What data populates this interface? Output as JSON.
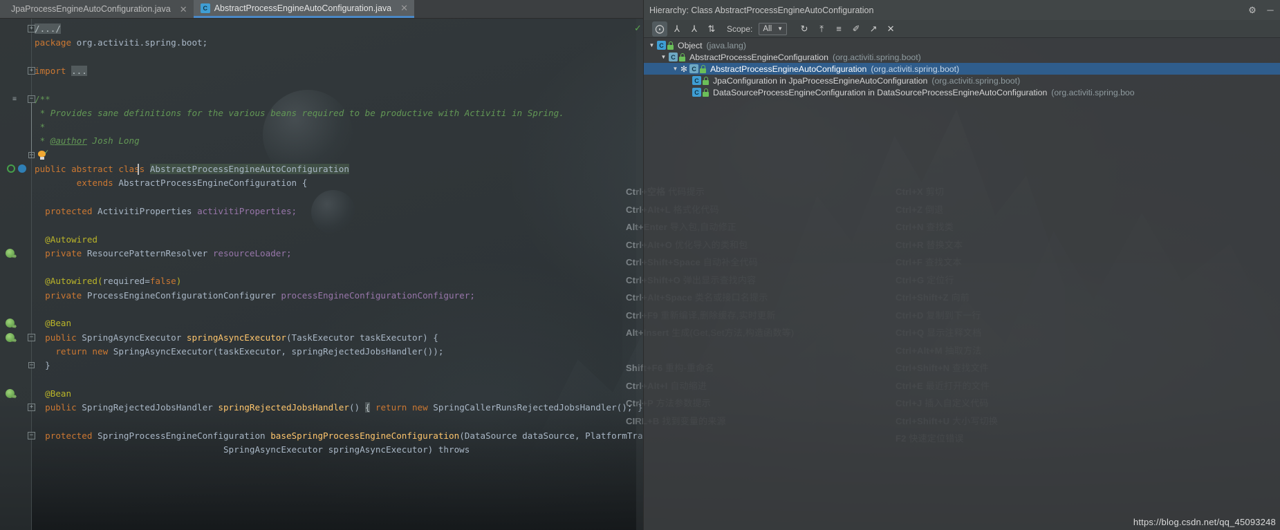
{
  "editor": {
    "tabs": [
      {
        "label": "JpaProcessEngineAutoConfiguration.java",
        "icon": "java-class-icon",
        "icon_letter": "C",
        "active": false,
        "closable": true
      },
      {
        "label": "AbstractProcessEngineAutoConfiguration.java",
        "icon": "java-class-icon",
        "icon_letter": "C",
        "active": true,
        "closable": true
      }
    ],
    "lines": [
      {
        "t": 0,
        "segments": [
          {
            "text": "/.../",
            "cls": "fold-hl"
          }
        ],
        "gutter": "fold-plus"
      },
      {
        "t": 1,
        "segments": [
          {
            "text": "package ",
            "cls": "kw"
          },
          {
            "text": "org.activiti.spring.boot;",
            "cls": "typ"
          }
        ]
      },
      {
        "t": 2,
        "segments": []
      },
      {
        "t": 3,
        "segments": [
          {
            "text": "import ",
            "cls": "kw"
          },
          {
            "text": "...",
            "cls": "fold-hl"
          }
        ],
        "gutter": "fold-plus"
      },
      {
        "t": 4,
        "segments": []
      },
      {
        "t": 5,
        "segments": [
          {
            "text": "/**",
            "cls": "cmtb"
          }
        ],
        "gutter": "fold-minus"
      },
      {
        "t": 6,
        "segments": [
          {
            "text": " * Provides sane definitions for the various beans required to be productive with Activiti in Spring.",
            "cls": "cmt"
          }
        ]
      },
      {
        "t": 7,
        "segments": [
          {
            "text": " *",
            "cls": "cmt"
          }
        ]
      },
      {
        "t": 8,
        "segments": [
          {
            "text": " * ",
            "cls": "cmt"
          },
          {
            "text": "@author",
            "cls": "cmt underline"
          },
          {
            "text": " Josh Long",
            "cls": "cmt"
          }
        ]
      },
      {
        "t": 9,
        "segments": [],
        "gutter": "brace-end"
      },
      {
        "t": 10,
        "segments": [
          {
            "text": "public abstract class ",
            "cls": "kw"
          },
          {
            "text": "AbstractProcessEngineAutoConfiguration",
            "cls": "cls-hl"
          }
        ],
        "gutter": "impl-override"
      },
      {
        "t": 11,
        "segments": [
          {
            "text": "        extends ",
            "cls": "kw"
          },
          {
            "text": "AbstractProcessEngineConfiguration {",
            "cls": "typ"
          }
        ]
      },
      {
        "t": 12,
        "segments": []
      },
      {
        "t": 13,
        "segments": [
          {
            "text": "  protected ",
            "cls": "kw"
          },
          {
            "text": "ActivitiProperties ",
            "cls": "typ"
          },
          {
            "text": "activitiProperties;",
            "cls": "fld"
          }
        ]
      },
      {
        "t": 14,
        "segments": []
      },
      {
        "t": 15,
        "segments": [
          {
            "text": "  @Autowired",
            "cls": "anno"
          }
        ]
      },
      {
        "t": 16,
        "segments": [
          {
            "text": "  private ",
            "cls": "kw"
          },
          {
            "text": "ResourcePatternResolver ",
            "cls": "typ"
          },
          {
            "text": "resourceLoader;",
            "cls": "fld"
          }
        ],
        "gutter": "spring-bean"
      },
      {
        "t": 17,
        "segments": []
      },
      {
        "t": 18,
        "segments": [
          {
            "text": "  @Autowired(",
            "cls": "anno"
          },
          {
            "text": "required=",
            "cls": "typ"
          },
          {
            "text": "false",
            "cls": "kw"
          },
          {
            "text": ")",
            "cls": "anno"
          }
        ]
      },
      {
        "t": 19,
        "segments": [
          {
            "text": "  private ",
            "cls": "kw"
          },
          {
            "text": "ProcessEngineConfigurationConfigurer ",
            "cls": "typ"
          },
          {
            "text": "processEngineConfigurationConfigurer;",
            "cls": "fld"
          }
        ]
      },
      {
        "t": 20,
        "segments": []
      },
      {
        "t": 21,
        "segments": [
          {
            "text": "  @Bean",
            "cls": "anno"
          }
        ],
        "gutter": "spring-bean"
      },
      {
        "t": 22,
        "segments": [
          {
            "text": "  public ",
            "cls": "kw"
          },
          {
            "text": "SpringAsyncExecutor ",
            "cls": "typ"
          },
          {
            "text": "springAsyncExecutor",
            "cls": "mth"
          },
          {
            "text": "(TaskExecutor taskExecutor) {",
            "cls": "typ"
          }
        ],
        "gutter": "spring-bean-fold"
      },
      {
        "t": 23,
        "segments": [
          {
            "text": "    return new ",
            "cls": "kw"
          },
          {
            "text": "SpringAsyncExecutor(taskExecutor, springRejectedJobsHandler());",
            "cls": "typ"
          }
        ]
      },
      {
        "t": 24,
        "segments": [
          {
            "text": "  }",
            "cls": "typ"
          }
        ],
        "gutter": "brace-end"
      },
      {
        "t": 25,
        "segments": []
      },
      {
        "t": 26,
        "segments": [
          {
            "text": "  @Bean",
            "cls": "anno"
          }
        ],
        "gutter": "spring-bean"
      },
      {
        "t": 27,
        "segments": [
          {
            "text": "  public ",
            "cls": "kw"
          },
          {
            "text": "SpringRejectedJobsHandler ",
            "cls": "typ"
          },
          {
            "text": "springRejectedJobsHandler",
            "cls": "mth"
          },
          {
            "text": "() ",
            "cls": "typ"
          },
          {
            "text": "{",
            "cls": "fold-hl"
          },
          {
            "text": " return new ",
            "cls": "kw"
          },
          {
            "text": "SpringCallerRunsRejectedJobsHandler(); }",
            "cls": "typ"
          }
        ],
        "gutter": "fold-plus"
      },
      {
        "t": 28,
        "segments": []
      },
      {
        "t": 29,
        "segments": [
          {
            "text": "  protected ",
            "cls": "kw"
          },
          {
            "text": "SpringProcessEngineConfiguration ",
            "cls": "typ"
          },
          {
            "text": "baseSpringProcessEngineConfiguration",
            "cls": "mth"
          },
          {
            "text": "(DataSource dataSource, PlatformTransactionManage",
            "cls": "typ"
          }
        ],
        "gutter": "fold-minus"
      },
      {
        "t": 30,
        "segments": [
          {
            "text": "                                    SpringAsyncExecutor springAsyncExecutor) throws",
            "cls": "typ"
          }
        ]
      }
    ]
  },
  "hierarchy": {
    "title": "Hierarchy:  Class AbstractProcessEngineAutoConfiguration",
    "window_actions": [
      {
        "name": "settings-gear-icon",
        "glyph": "⚙"
      },
      {
        "name": "minimize-icon",
        "glyph": "─"
      }
    ],
    "toolbar": {
      "buttons": [
        {
          "name": "type-hierarchy-icon",
          "glyph": "⨀",
          "selected": true
        },
        {
          "name": "supertypes-hierarchy-icon",
          "glyph": "⅄",
          "selected": false
        },
        {
          "name": "subtypes-hierarchy-icon",
          "glyph": "⅄",
          "selected": false
        },
        {
          "name": "sort-alphabetically-icon",
          "glyph": "⇅",
          "selected": false
        }
      ],
      "scope_label": "Scope:",
      "scope_value": "All",
      "right_buttons": [
        {
          "name": "refresh-icon",
          "glyph": "↻"
        },
        {
          "name": "export-to-text-icon",
          "glyph": "⤒"
        },
        {
          "name": "expand-all-icon",
          "glyph": "≡"
        },
        {
          "name": "pin-tab-icon",
          "glyph": "✐"
        },
        {
          "name": "open-in-new-window-icon",
          "glyph": "↗"
        },
        {
          "name": "close-icon",
          "glyph": "✕"
        }
      ]
    },
    "tree": [
      {
        "indent": 0,
        "arrow": "▼",
        "star": false,
        "name": "Object",
        "pkg": "(java.lang)",
        "selected": false,
        "abstract": false
      },
      {
        "indent": 1,
        "arrow": "▼",
        "star": false,
        "name": "AbstractProcessEngineConfiguration",
        "pkg": "(org.activiti.spring.boot)",
        "selected": false,
        "abstract": true
      },
      {
        "indent": 2,
        "arrow": "▼",
        "star": true,
        "name": "AbstractProcessEngineAutoConfiguration",
        "pkg": "(org.activiti.spring.boot)",
        "selected": true,
        "abstract": true
      },
      {
        "indent": 3,
        "arrow": "",
        "star": false,
        "name": "JpaConfiguration in JpaProcessEngineAutoConfiguration",
        "pkg": "(org.activiti.spring.boot)",
        "selected": false,
        "abstract": false
      },
      {
        "indent": 3,
        "arrow": "",
        "star": false,
        "name": "DataSourceProcessEngineConfiguration in DataSourceProcessEngineAutoConfiguration",
        "pkg": "(org.activiti.spring.boo",
        "selected": false,
        "abstract": false
      }
    ]
  },
  "shortcuts_overlay": {
    "left_column": [
      {
        "key": "Ctrl+空格",
        "desc": "代码提示"
      },
      {
        "key": "Ctrl+Alt+L",
        "desc": "格式化代码"
      },
      {
        "key": "Alt+Enter",
        "desc": "导入包,自动修正"
      },
      {
        "key": "Ctrl+Alt+O",
        "desc": "优化导入的类和包"
      },
      {
        "key": "Ctrl+Shift+Space",
        "desc": "自动补全代码"
      },
      {
        "key": "Ctrl+Shift+O",
        "desc": "弹出显示查找内容"
      },
      {
        "key": "Ctrl+Alt+Space",
        "desc": "类名或接口名提示"
      },
      {
        "key": "Ctrl+F9",
        "desc": "重新编译,删除缓存,实时更新"
      },
      {
        "key": "Alt+Insert",
        "desc": "生成(Get,Set方法,构造函数等)"
      },
      {
        "key": "",
        "desc": ""
      },
      {
        "key": "Shift+F6",
        "desc": "重构-重命名"
      },
      {
        "key": "Ctrl+Alt+I",
        "desc": "自动缩进"
      },
      {
        "key": "Ctrl+P",
        "desc": "方法参数提示"
      },
      {
        "key": "CIRL+B",
        "desc": "找到变量的来源"
      }
    ],
    "right_column": [
      {
        "key": "Ctrl+X",
        "desc": "剪切"
      },
      {
        "key": "Ctrl+Z",
        "desc": "倒退"
      },
      {
        "key": "Ctrl+N",
        "desc": "查找类"
      },
      {
        "key": "Ctrl+R",
        "desc": "替换文本"
      },
      {
        "key": "Ctrl+F",
        "desc": "查找文本"
      },
      {
        "key": "Ctrl+G",
        "desc": "定位行"
      },
      {
        "key": "Ctrl+Shift+Z",
        "desc": "向前"
      },
      {
        "key": "Ctrl+D",
        "desc": "复制到下一行"
      },
      {
        "key": "Ctrl+Q",
        "desc": "显示注释文档"
      },
      {
        "key": "Ctrl+Alt+M",
        "desc": "抽取方法"
      },
      {
        "key": "Ctrl+Shift+N",
        "desc": "查找文件"
      },
      {
        "key": "Ctrl+E",
        "desc": "最近打开的文件"
      },
      {
        "key": "Ctrl+J",
        "desc": "插入自定义代码"
      },
      {
        "key": "Ctrl+Shift+U",
        "desc": "大小写切换"
      },
      {
        "key": "F2",
        "desc": "快速定位错误"
      }
    ]
  },
  "watermark": {
    "url": "https://blog.csdn.net/qq_45093248"
  },
  "colors": {
    "accent": "#4a88c7",
    "selection": "#2f5d8c",
    "keyword": "#cc7832",
    "comment": "#629755",
    "annotation": "#bbb529",
    "field": "#9876aa",
    "method": "#ffc66d",
    "text": "#a9b7c6"
  }
}
